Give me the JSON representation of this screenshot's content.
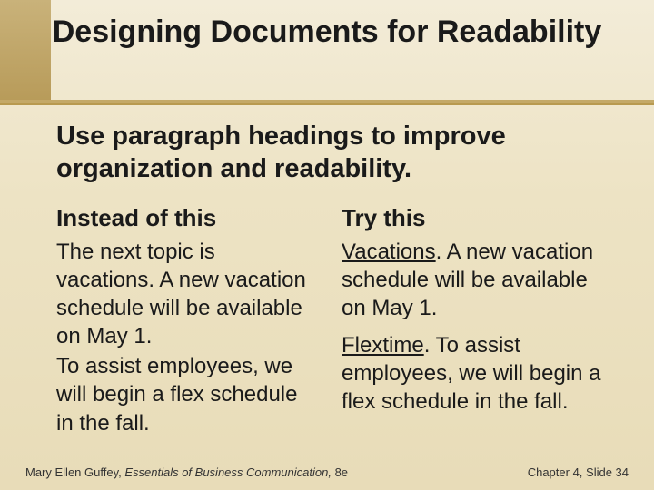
{
  "title": "Designing Documents for Readability",
  "subtitle": "Use paragraph headings to improve organization and readability.",
  "columns": {
    "left": {
      "heading": "Instead of this",
      "p1": "The next topic is vacations. A new vacation schedule will be available on May 1.",
      "p2": "To assist employees, we will begin a flex schedule in the fall."
    },
    "right": {
      "heading": "Try this",
      "p1_run": "Vacations",
      "p1_rest": ".  A new vacation schedule will be available on May 1.",
      "p2_run": "Flextime",
      "p2_rest": ". To assist employees, we will begin a flex schedule in the fall."
    }
  },
  "footer": {
    "author": "Mary Ellen Guffey, ",
    "book": "Essentials of Business Communication, ",
    "edition": "8e",
    "right": "Chapter 4, Slide 34"
  }
}
